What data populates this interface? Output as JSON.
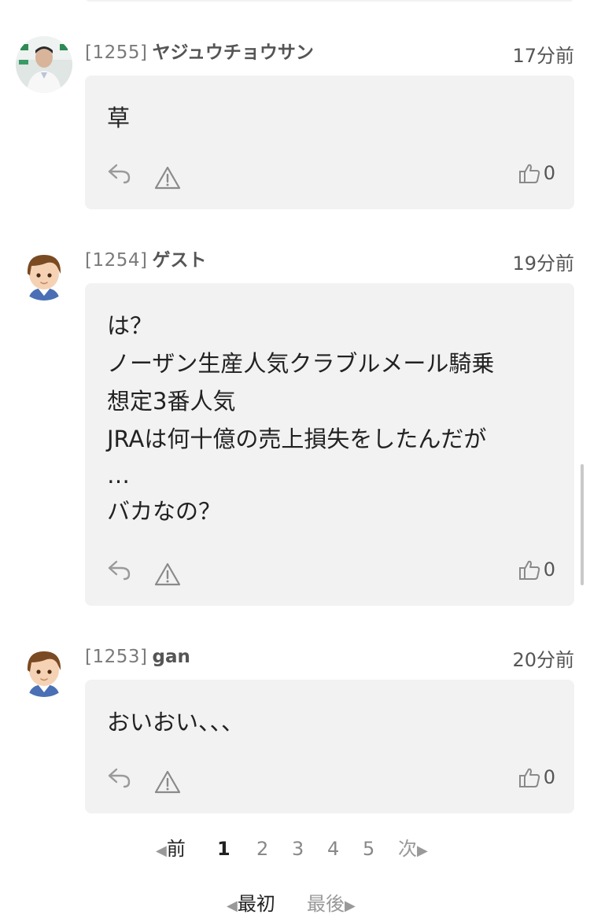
{
  "comments": [
    {
      "number": "[1255]",
      "name": "ヤジュウチョウサン",
      "time": "17分前",
      "lines": [
        "草"
      ],
      "likes": "0",
      "avatar": "photo-avatar"
    },
    {
      "number": "[1254]",
      "name": "ゲスト",
      "time": "19分前",
      "lines": [
        "は？",
        "ノーザン生産人気クラブルメール騎乗",
        "想定3番人気",
        "JRAは何十億の売上損失をしたんだが",
        "…",
        "バカなの？"
      ],
      "likes": "0",
      "avatar": "guest-avatar"
    },
    {
      "number": "[1253]",
      "name": "gan",
      "time": "20分前",
      "lines": [
        "おいおい、、、"
      ],
      "likes": "0",
      "avatar": "guest-avatar"
    }
  ],
  "pagination": {
    "prev": "前",
    "pages": [
      "1",
      "2",
      "3",
      "4",
      "5"
    ],
    "current": "1",
    "next": "次",
    "first": "最初",
    "last": "最後"
  }
}
